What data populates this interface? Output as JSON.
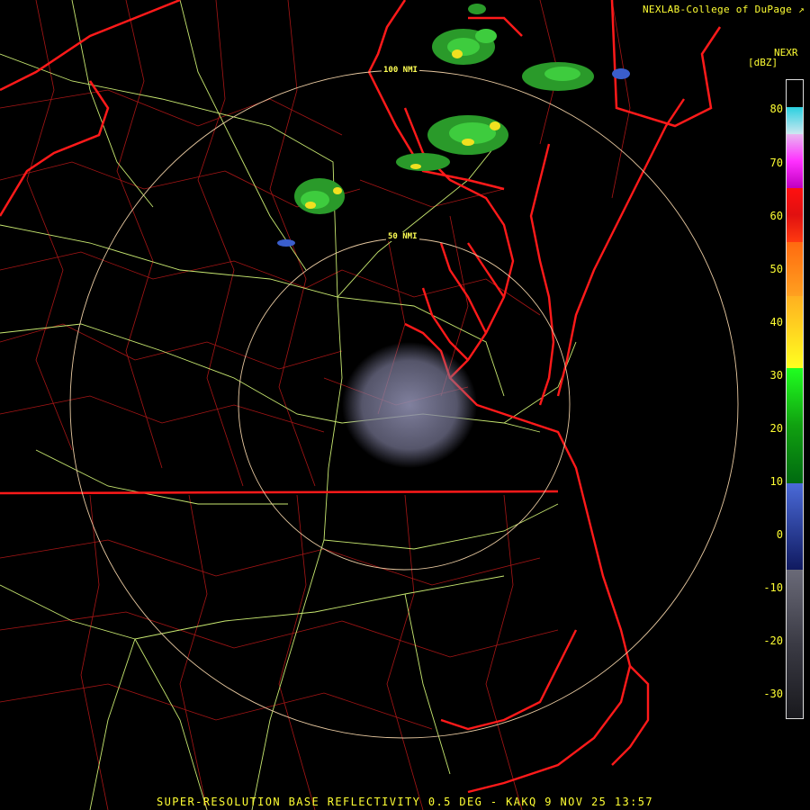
{
  "header": {
    "credit": "NEXLAB-College of DuPage",
    "credit_icon": "external-link-icon"
  },
  "legend": {
    "product": "NEXR",
    "units": "[dBZ]",
    "ticks": [
      "80",
      "70",
      "60",
      "50",
      "40",
      "30",
      "20",
      "10",
      "0",
      "-10",
      "-20",
      "-30"
    ]
  },
  "range_rings": {
    "inner_label": "50 NMI",
    "outer_label": "100 NMI"
  },
  "footer": {
    "caption": "SUPER-RESOLUTION BASE REFLECTIVITY 0.5 DEG - KAKQ 9 NOV 25 13:57"
  },
  "colors": {
    "background": "#000000",
    "state_borders": "#ff1a1a",
    "county_lines": "#b01818",
    "highways": "#c8e870",
    "range_rings": "#e8c9a0",
    "text": "#ffff33",
    "clutter": "#8a8aa8"
  }
}
